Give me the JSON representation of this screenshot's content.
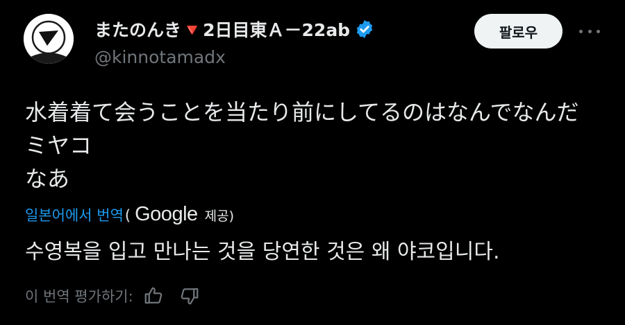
{
  "author": {
    "display_name": "またのんき🔻2日目東Ａ－22ab",
    "handle": "@kinnotamadx",
    "verified": true
  },
  "follow_button": {
    "label": "팔로우"
  },
  "post": {
    "lines": [
      "水着着て会うことを当たり前にしてるのはなんでなんだ",
      "ミヤコ",
      "なあ"
    ]
  },
  "translation": {
    "link_label": "일본어에서 번역",
    "paren_open": "(",
    "provider": "Google",
    "provided_label": "제공)",
    "text": "수영복을 입고 만나는 것을 당연한 것은 왜 야코입니다."
  },
  "rating": {
    "label": "이 번역 평가하기:"
  },
  "icons": {
    "verified": "verified-badge-icon",
    "more": "more-options-icon",
    "thumbs_up": "thumbs-up-icon",
    "thumbs_down": "thumbs-down-icon"
  },
  "colors": {
    "background": "#000000",
    "text": "#e7e9ea",
    "muted": "#71767b",
    "link": "#1d9bf0",
    "verified": "#1d9bf0",
    "follow_bg": "#eff3f4"
  }
}
